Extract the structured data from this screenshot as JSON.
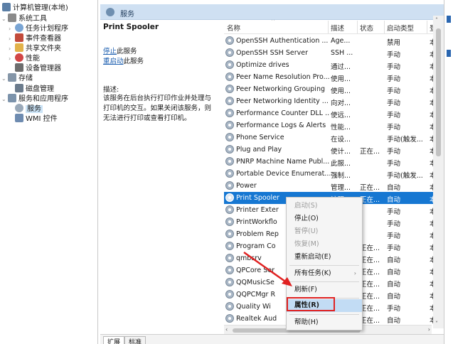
{
  "tree": [
    {
      "label": "计算机管理(本地)",
      "icon": "computer-icon",
      "level": 0
    },
    {
      "label": "系统工具",
      "icon": "tools-icon",
      "level": 1
    },
    {
      "label": "任务计划程序",
      "icon": "clock-icon",
      "level": 2
    },
    {
      "label": "事件查看器",
      "icon": "event-viewer-icon",
      "level": 2
    },
    {
      "label": "共享文件夹",
      "icon": "shared-folder-icon",
      "level": 2
    },
    {
      "label": "性能",
      "icon": "performance-icon",
      "level": 2
    },
    {
      "label": "设备管理器",
      "icon": "device-manager-icon",
      "level": 2
    },
    {
      "label": "存储",
      "icon": "storage-icon",
      "level": 1
    },
    {
      "label": "磁盘管理",
      "icon": "disk-icon",
      "level": 2
    },
    {
      "label": "服务和应用程序",
      "icon": "services-apps-icon",
      "level": 1
    },
    {
      "label": "服务",
      "icon": "services-icon",
      "level": 2,
      "selected": true
    },
    {
      "label": "WMI 控件",
      "icon": "wmi-icon",
      "level": 2
    }
  ],
  "header": {
    "title": "服务"
  },
  "description": {
    "service_name": "Print Spooler",
    "stop_link": "停止",
    "stop_suffix": "此服务",
    "restart_link": "重启动",
    "restart_suffix": "此服务",
    "desc_label": "描述:",
    "desc_text": "该服务在后台执行打印作业并处理与打印机的交互。如果关闭该服务，则无法进行打印或查看打印机。"
  },
  "columns": {
    "name": "名称",
    "desc": "描述",
    "status": "状态",
    "startup": "启动类型",
    "logon": "登"
  },
  "services": [
    {
      "name": "OpenSSH Authentication ...",
      "desc": "Age...",
      "status": "",
      "startup": "禁用",
      "logon": "本"
    },
    {
      "name": "OpenSSH SSH Server",
      "desc": "SSH ...",
      "status": "",
      "startup": "手动",
      "logon": "本"
    },
    {
      "name": "Optimize drives",
      "desc": "通过...",
      "status": "",
      "startup": "手动",
      "logon": "本"
    },
    {
      "name": "Peer Name Resolution Pro...",
      "desc": "使用...",
      "status": "",
      "startup": "手动",
      "logon": "本"
    },
    {
      "name": "Peer Networking Grouping",
      "desc": "使用...",
      "status": "",
      "startup": "手动",
      "logon": "本"
    },
    {
      "name": "Peer Networking Identity ...",
      "desc": "向对...",
      "status": "",
      "startup": "手动",
      "logon": "本"
    },
    {
      "name": "Performance Counter DLL ...",
      "desc": "使远...",
      "status": "",
      "startup": "手动",
      "logon": "本"
    },
    {
      "name": "Performance Logs & Alerts",
      "desc": "性能...",
      "status": "",
      "startup": "手动",
      "logon": "本"
    },
    {
      "name": "Phone Service",
      "desc": "在设...",
      "status": "",
      "startup": "手动(触发...",
      "logon": "本"
    },
    {
      "name": "Plug and Play",
      "desc": "使计...",
      "status": "正在...",
      "startup": "手动",
      "logon": "本"
    },
    {
      "name": "PNRP Machine Name Publ...",
      "desc": "此服...",
      "status": "",
      "startup": "手动",
      "logon": "本"
    },
    {
      "name": "Portable Device Enumerat...",
      "desc": "强制...",
      "status": "",
      "startup": "手动(触发...",
      "logon": "本"
    },
    {
      "name": "Power",
      "desc": "管理...",
      "status": "正在...",
      "startup": "自动",
      "logon": "本"
    },
    {
      "name": "Print Spooler",
      "desc": "该服...",
      "status": "正在...",
      "startup": "自动",
      "logon": "本",
      "selected": true
    },
    {
      "name": "Printer Exter",
      "desc": "",
      "status": "",
      "startup": "手动",
      "logon": "本"
    },
    {
      "name": "PrintWorkflo",
      "desc": "",
      "status": "",
      "startup": "手动",
      "logon": "本"
    },
    {
      "name": "Problem Rep",
      "desc": "",
      "status": "",
      "startup": "手动",
      "logon": "本"
    },
    {
      "name": "Program Co",
      "desc": "",
      "status": "正在...",
      "startup": "手动",
      "logon": "本"
    },
    {
      "name": "qmbsrv",
      "desc": "",
      "status": "正在...",
      "startup": "自动",
      "logon": "本"
    },
    {
      "name": "QPCore Ser",
      "desc": "",
      "status": "正在...",
      "startup": "自动",
      "logon": "本"
    },
    {
      "name": "QQMusicSe",
      "desc": "",
      "status": "正在...",
      "startup": "自动",
      "logon": "本"
    },
    {
      "name": "QQPCMgr R",
      "desc": "",
      "status": "正在...",
      "startup": "自动",
      "logon": "本"
    },
    {
      "name": "Quality Wi",
      "desc": "",
      "status": "正在...",
      "startup": "手动",
      "logon": "本"
    },
    {
      "name": "Realtek Aud",
      "desc": "",
      "status": "正在...",
      "startup": "自动",
      "logon": "本"
    }
  ],
  "context_menu": {
    "start": "启动(S)",
    "stop": "停止(O)",
    "pause": "暂停(U)",
    "resume": "恢复(M)",
    "restart": "重新启动(E)",
    "all_tasks": "所有任务(K)",
    "refresh": "刷新(F)",
    "properties": "属性(R)",
    "help": "帮助(H)"
  },
  "tabs": {
    "extended": "扩展",
    "standard": "标准"
  },
  "colors": {
    "selection": "#1677d2",
    "highlight_box": "#e02222",
    "arrow": "#e02222"
  }
}
